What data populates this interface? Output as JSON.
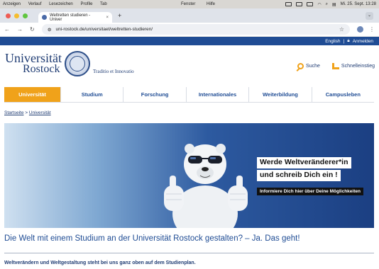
{
  "os_menubar": {
    "items": [
      "Anzeigen",
      "Verlauf",
      "Lesezeichen",
      "Profile",
      "Tab"
    ],
    "items_right": [
      "Fenster",
      "Hilfe"
    ],
    "clock": "Mi. 25. Sept. 13:28"
  },
  "browser": {
    "tab_title": "Weltretten studieren - Univer",
    "tab_close": "×",
    "new_tab": "+",
    "url": "uni-rostock.de/universitaet/weltretten-studieren/"
  },
  "topbar": {
    "language": "English",
    "separator": "|",
    "login": "Anmelden"
  },
  "header": {
    "logo_line1": "Universität",
    "logo_line2": "Rostock",
    "motto": "Traditio et Innovatio",
    "search_label": "Suche",
    "quick_label": "Schnelleinstieg"
  },
  "nav": {
    "items": [
      "Universität",
      "Studium",
      "Forschung",
      "Internationales",
      "Weiterbildung",
      "Campusleben"
    ]
  },
  "breadcrumb": {
    "home": "Startseite",
    "sep": ">",
    "current": "Universität"
  },
  "hero": {
    "line1": "Werde Weltveränderer*in",
    "line2": "und schreib Dich ein !",
    "line3": "Informiere Dich hier über Deine Möglichkeiten"
  },
  "content": {
    "headline": "Die Welt mit einem Studium an der Universität Rostock gestalten? – Ja. Das geht!",
    "subline": "Weltverändern und Weltgestaltung steht bei uns ganz oben auf dem Studienplan."
  },
  "colors": {
    "brand_blue": "#1f4c94",
    "accent_orange": "#f0a21a"
  }
}
